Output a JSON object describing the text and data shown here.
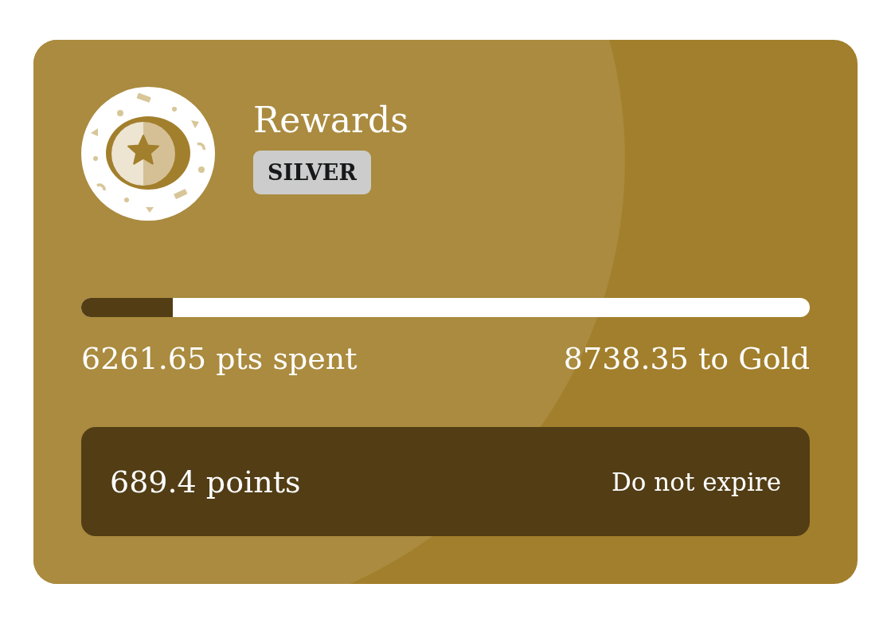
{
  "card": {
    "title": "Rewards",
    "tier_badge": "SILVER",
    "progress": {
      "level": 0.126
    },
    "spent": "6261.65 pts spent",
    "to_next_tier": "8738.35 to Gold",
    "balance": {
      "points": "689.4 points",
      "expiry": "Do not expire"
    }
  }
}
